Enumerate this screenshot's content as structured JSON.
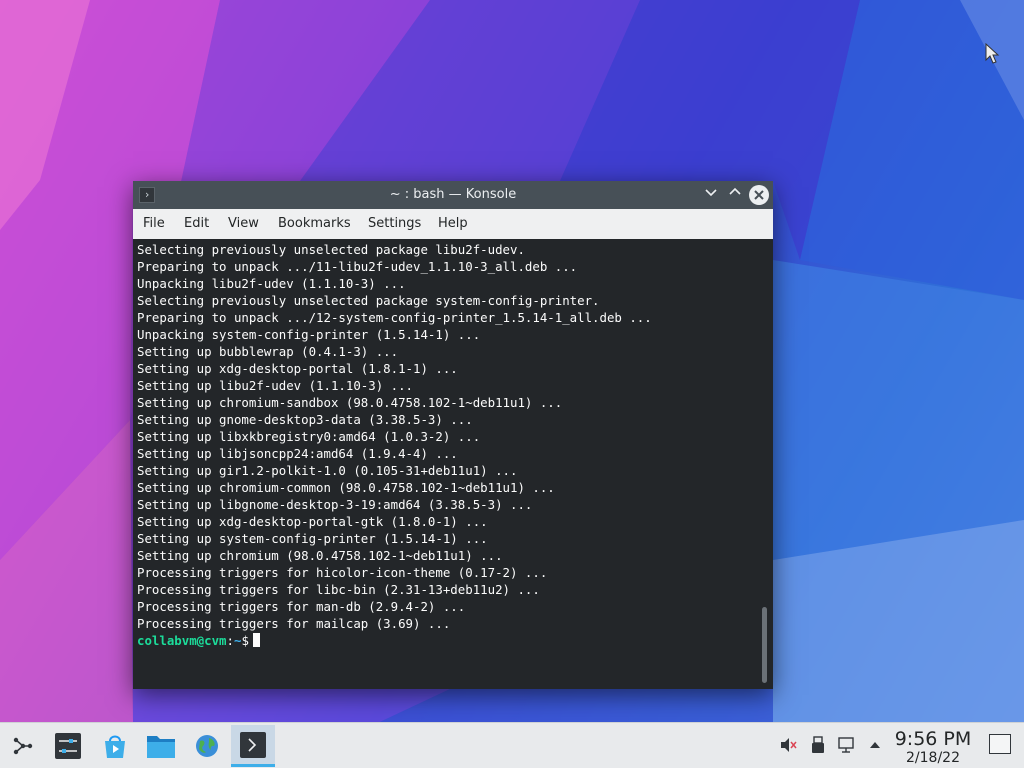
{
  "window": {
    "title": "~ : bash — Konsole",
    "app_icon": "terminal-icon",
    "minimize_icon": "chevron-down-icon",
    "maximize_icon": "chevron-up-icon",
    "close_icon": "close-icon"
  },
  "menu": {
    "items": [
      "File",
      "Edit",
      "View",
      "Bookmarks",
      "Settings",
      "Help"
    ]
  },
  "terminal": {
    "lines": [
      "Selecting previously unselected package libu2f-udev.",
      "Preparing to unpack .../11-libu2f-udev_1.1.10-3_all.deb ...",
      "Unpacking libu2f-udev (1.1.10-3) ...",
      "Selecting previously unselected package system-config-printer.",
      "Preparing to unpack .../12-system-config-printer_1.5.14-1_all.deb ...",
      "Unpacking system-config-printer (1.5.14-1) ...",
      "Setting up bubblewrap (0.4.1-3) ...",
      "Setting up xdg-desktop-portal (1.8.1-1) ...",
      "Setting up libu2f-udev (1.1.10-3) ...",
      "Setting up chromium-sandbox (98.0.4758.102-1~deb11u1) ...",
      "Setting up gnome-desktop3-data (3.38.5-3) ...",
      "Setting up libxkbregistry0:amd64 (1.0.3-2) ...",
      "Setting up libjsoncpp24:amd64 (1.9.4-4) ...",
      "Setting up gir1.2-polkit-1.0 (0.105-31+deb11u1) ...",
      "Setting up chromium-common (98.0.4758.102-1~deb11u1) ...",
      "Setting up libgnome-desktop-3-19:amd64 (3.38.5-3) ...",
      "Setting up xdg-desktop-portal-gtk (1.8.0-1) ...",
      "Setting up system-config-printer (1.5.14-1) ...",
      "Setting up chromium (98.0.4758.102-1~deb11u1) ...",
      "Processing triggers for hicolor-icon-theme (0.17-2) ...",
      "Processing triggers for libc-bin (2.31-13+deb11u2) ...",
      "Processing triggers for man-db (2.9.4-2) ...",
      "Processing triggers for mailcap (3.69) ..."
    ],
    "prompt_user": "collabvm@cvm",
    "prompt_sep": ":",
    "prompt_path": "~",
    "prompt_symbol": "$"
  },
  "taskbar": {
    "launchers": [
      {
        "name": "application-launcher",
        "icon": "kde-launcher-icon"
      },
      {
        "name": "system-settings",
        "icon": "settings-sliders-icon"
      },
      {
        "name": "discover",
        "icon": "discover-store-icon"
      },
      {
        "name": "file-manager",
        "icon": "folder-icon"
      },
      {
        "name": "web-browser",
        "icon": "globe-icon"
      },
      {
        "name": "konsole",
        "icon": "terminal-icon"
      }
    ],
    "tray": [
      "volume-muted-icon",
      "usb-device-icon",
      "network-wired-icon",
      "tray-expand-icon"
    ],
    "clock_time": "9:56 PM",
    "clock_date": "2/18/22",
    "show_desktop_icon": "show-desktop-icon"
  },
  "colors": {
    "titlebar": "#475057",
    "terminal_bg": "#232629",
    "prompt_user": "#1cdc9a",
    "prompt_path": "#3daee9",
    "taskbar_bg": "#e8eaec"
  }
}
